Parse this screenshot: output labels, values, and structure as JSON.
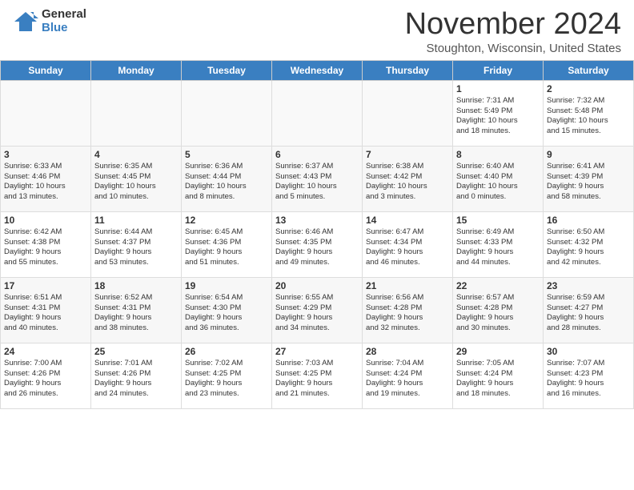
{
  "logo": {
    "general": "General",
    "blue": "Blue"
  },
  "title": "November 2024",
  "location": "Stoughton, Wisconsin, United States",
  "days_of_week": [
    "Sunday",
    "Monday",
    "Tuesday",
    "Wednesday",
    "Thursday",
    "Friday",
    "Saturday"
  ],
  "weeks": [
    [
      {
        "day": "",
        "info": "",
        "empty": true
      },
      {
        "day": "",
        "info": "",
        "empty": true
      },
      {
        "day": "",
        "info": "",
        "empty": true
      },
      {
        "day": "",
        "info": "",
        "empty": true
      },
      {
        "day": "",
        "info": "",
        "empty": true
      },
      {
        "day": "1",
        "info": "Sunrise: 7:31 AM\nSunset: 5:49 PM\nDaylight: 10 hours\nand 18 minutes."
      },
      {
        "day": "2",
        "info": "Sunrise: 7:32 AM\nSunset: 5:48 PM\nDaylight: 10 hours\nand 15 minutes."
      }
    ],
    [
      {
        "day": "3",
        "info": "Sunrise: 6:33 AM\nSunset: 4:46 PM\nDaylight: 10 hours\nand 13 minutes."
      },
      {
        "day": "4",
        "info": "Sunrise: 6:35 AM\nSunset: 4:45 PM\nDaylight: 10 hours\nand 10 minutes."
      },
      {
        "day": "5",
        "info": "Sunrise: 6:36 AM\nSunset: 4:44 PM\nDaylight: 10 hours\nand 8 minutes."
      },
      {
        "day": "6",
        "info": "Sunrise: 6:37 AM\nSunset: 4:43 PM\nDaylight: 10 hours\nand 5 minutes."
      },
      {
        "day": "7",
        "info": "Sunrise: 6:38 AM\nSunset: 4:42 PM\nDaylight: 10 hours\nand 3 minutes."
      },
      {
        "day": "8",
        "info": "Sunrise: 6:40 AM\nSunset: 4:40 PM\nDaylight: 10 hours\nand 0 minutes."
      },
      {
        "day": "9",
        "info": "Sunrise: 6:41 AM\nSunset: 4:39 PM\nDaylight: 9 hours\nand 58 minutes."
      }
    ],
    [
      {
        "day": "10",
        "info": "Sunrise: 6:42 AM\nSunset: 4:38 PM\nDaylight: 9 hours\nand 55 minutes."
      },
      {
        "day": "11",
        "info": "Sunrise: 6:44 AM\nSunset: 4:37 PM\nDaylight: 9 hours\nand 53 minutes."
      },
      {
        "day": "12",
        "info": "Sunrise: 6:45 AM\nSunset: 4:36 PM\nDaylight: 9 hours\nand 51 minutes."
      },
      {
        "day": "13",
        "info": "Sunrise: 6:46 AM\nSunset: 4:35 PM\nDaylight: 9 hours\nand 49 minutes."
      },
      {
        "day": "14",
        "info": "Sunrise: 6:47 AM\nSunset: 4:34 PM\nDaylight: 9 hours\nand 46 minutes."
      },
      {
        "day": "15",
        "info": "Sunrise: 6:49 AM\nSunset: 4:33 PM\nDaylight: 9 hours\nand 44 minutes."
      },
      {
        "day": "16",
        "info": "Sunrise: 6:50 AM\nSunset: 4:32 PM\nDaylight: 9 hours\nand 42 minutes."
      }
    ],
    [
      {
        "day": "17",
        "info": "Sunrise: 6:51 AM\nSunset: 4:31 PM\nDaylight: 9 hours\nand 40 minutes."
      },
      {
        "day": "18",
        "info": "Sunrise: 6:52 AM\nSunset: 4:31 PM\nDaylight: 9 hours\nand 38 minutes."
      },
      {
        "day": "19",
        "info": "Sunrise: 6:54 AM\nSunset: 4:30 PM\nDaylight: 9 hours\nand 36 minutes."
      },
      {
        "day": "20",
        "info": "Sunrise: 6:55 AM\nSunset: 4:29 PM\nDaylight: 9 hours\nand 34 minutes."
      },
      {
        "day": "21",
        "info": "Sunrise: 6:56 AM\nSunset: 4:28 PM\nDaylight: 9 hours\nand 32 minutes."
      },
      {
        "day": "22",
        "info": "Sunrise: 6:57 AM\nSunset: 4:28 PM\nDaylight: 9 hours\nand 30 minutes."
      },
      {
        "day": "23",
        "info": "Sunrise: 6:59 AM\nSunset: 4:27 PM\nDaylight: 9 hours\nand 28 minutes."
      }
    ],
    [
      {
        "day": "24",
        "info": "Sunrise: 7:00 AM\nSunset: 4:26 PM\nDaylight: 9 hours\nand 26 minutes."
      },
      {
        "day": "25",
        "info": "Sunrise: 7:01 AM\nSunset: 4:26 PM\nDaylight: 9 hours\nand 24 minutes."
      },
      {
        "day": "26",
        "info": "Sunrise: 7:02 AM\nSunset: 4:25 PM\nDaylight: 9 hours\nand 23 minutes."
      },
      {
        "day": "27",
        "info": "Sunrise: 7:03 AM\nSunset: 4:25 PM\nDaylight: 9 hours\nand 21 minutes."
      },
      {
        "day": "28",
        "info": "Sunrise: 7:04 AM\nSunset: 4:24 PM\nDaylight: 9 hours\nand 19 minutes."
      },
      {
        "day": "29",
        "info": "Sunrise: 7:05 AM\nSunset: 4:24 PM\nDaylight: 9 hours\nand 18 minutes."
      },
      {
        "day": "30",
        "info": "Sunrise: 7:07 AM\nSunset: 4:23 PM\nDaylight: 9 hours\nand 16 minutes."
      }
    ]
  ]
}
